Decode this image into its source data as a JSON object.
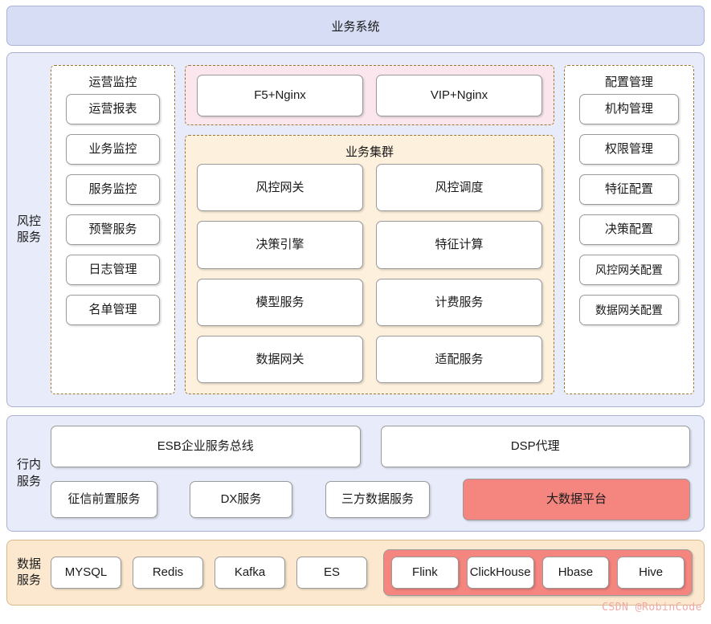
{
  "banner": {
    "title": "业务系统"
  },
  "sections": {
    "risk": {
      "label": "风控\n服务",
      "label_line1": "风控",
      "label_line2": "服务",
      "monitor_group": {
        "title": "运营监控",
        "items": [
          "运营报表",
          "业务监控",
          "服务监控",
          "预警服务",
          "日志管理",
          "名单管理"
        ]
      },
      "loadbalancer_group": {
        "items": [
          "F5+Nginx",
          "VIP+Nginx"
        ]
      },
      "cluster_group": {
        "title": "业务集群",
        "items": [
          "风控网关",
          "风控调度",
          "决策引擎",
          "特征计算",
          "模型服务",
          "计费服务",
          "数据网关",
          "适配服务"
        ]
      },
      "config_group": {
        "title": "配置管理",
        "items": [
          "机构管理",
          "权限管理",
          "特征配置",
          "决策配置",
          "风控网关配置",
          "数据网关配置"
        ]
      }
    },
    "intra": {
      "label_line1": "行内",
      "label_line2": "服务",
      "top_items": [
        "ESB企业服务总线",
        "DSP代理"
      ],
      "bottom_items": [
        "征信前置服务",
        "DX服务",
        "三方数据服务",
        "大数据平台"
      ]
    },
    "data": {
      "label_line1": "数据",
      "label_line2": "服务",
      "plain_items": [
        "MYSQL",
        "Redis",
        "Kafka",
        "ES"
      ],
      "highlight_items": [
        "Flink",
        "ClickHouse",
        "Hbase",
        "Hive"
      ]
    }
  },
  "watermark": "CSDN @RobinCode",
  "colors": {
    "banner_bg": "#d6ddf4",
    "section_bg": "#e8ecfa",
    "data_section_bg": "#fbe8cf",
    "pink_group_bg": "#fbe6ee",
    "cream_group_bg": "#fdf0dd",
    "dashed_border": "#9a7533",
    "highlight_red": "#f5857f",
    "node_border": "#9a9a9a"
  }
}
